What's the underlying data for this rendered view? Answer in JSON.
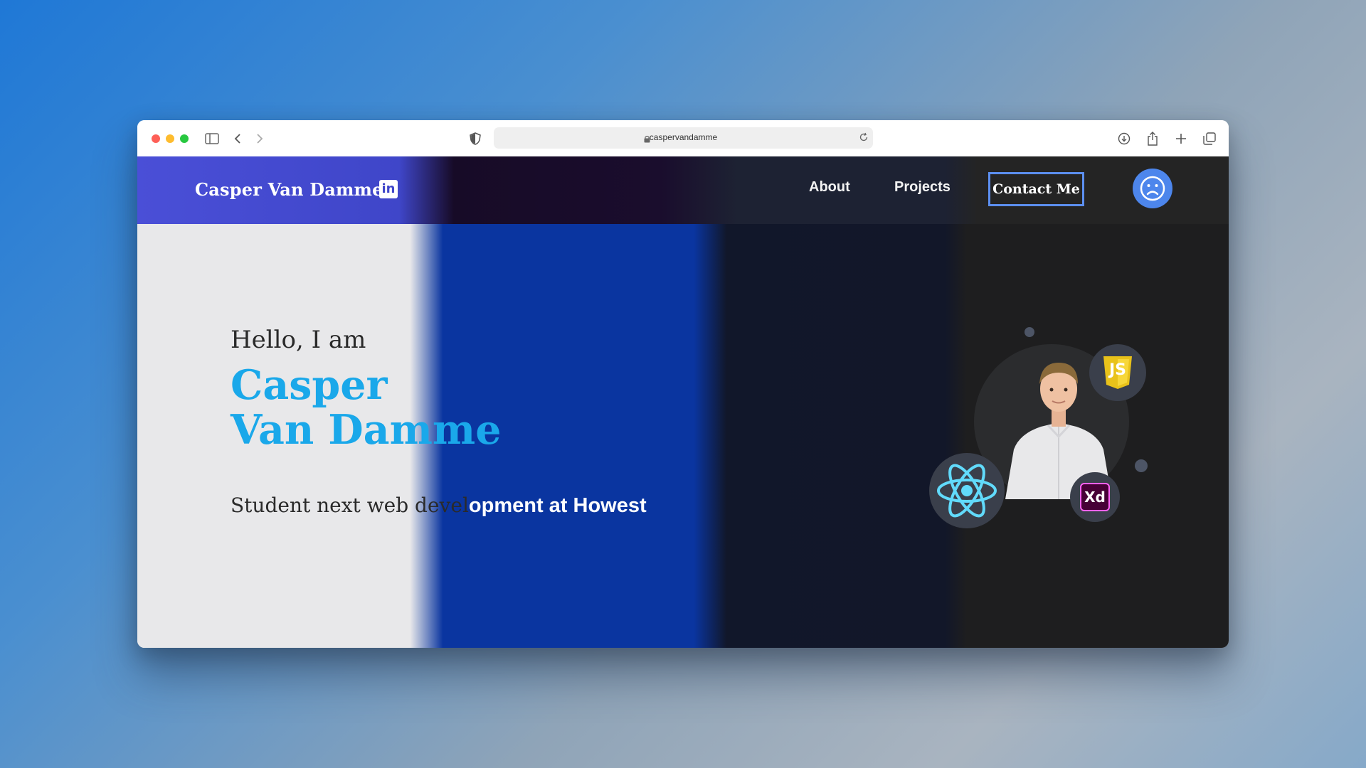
{
  "browser": {
    "url": "caspervandamme"
  },
  "nav": {
    "brand": "Casper Van Damme",
    "linkedin_label": "in",
    "links": [
      "About",
      "Projects"
    ],
    "contact_label": "Contact Me"
  },
  "hero": {
    "greeting": "Hello, I am",
    "name_line1": "Casper",
    "name_line2": "Van Damme",
    "subtitle_part1": "Student next web devel",
    "subtitle_part2": "opment at Howest"
  },
  "skills": {
    "js_label": "JS",
    "xd_label": "Xd"
  },
  "colors": {
    "accent": "#1aa8ea",
    "nav_left": "#4a4fd7",
    "contact_border": "#5c8ff0",
    "toggle": "#4d86ec"
  }
}
